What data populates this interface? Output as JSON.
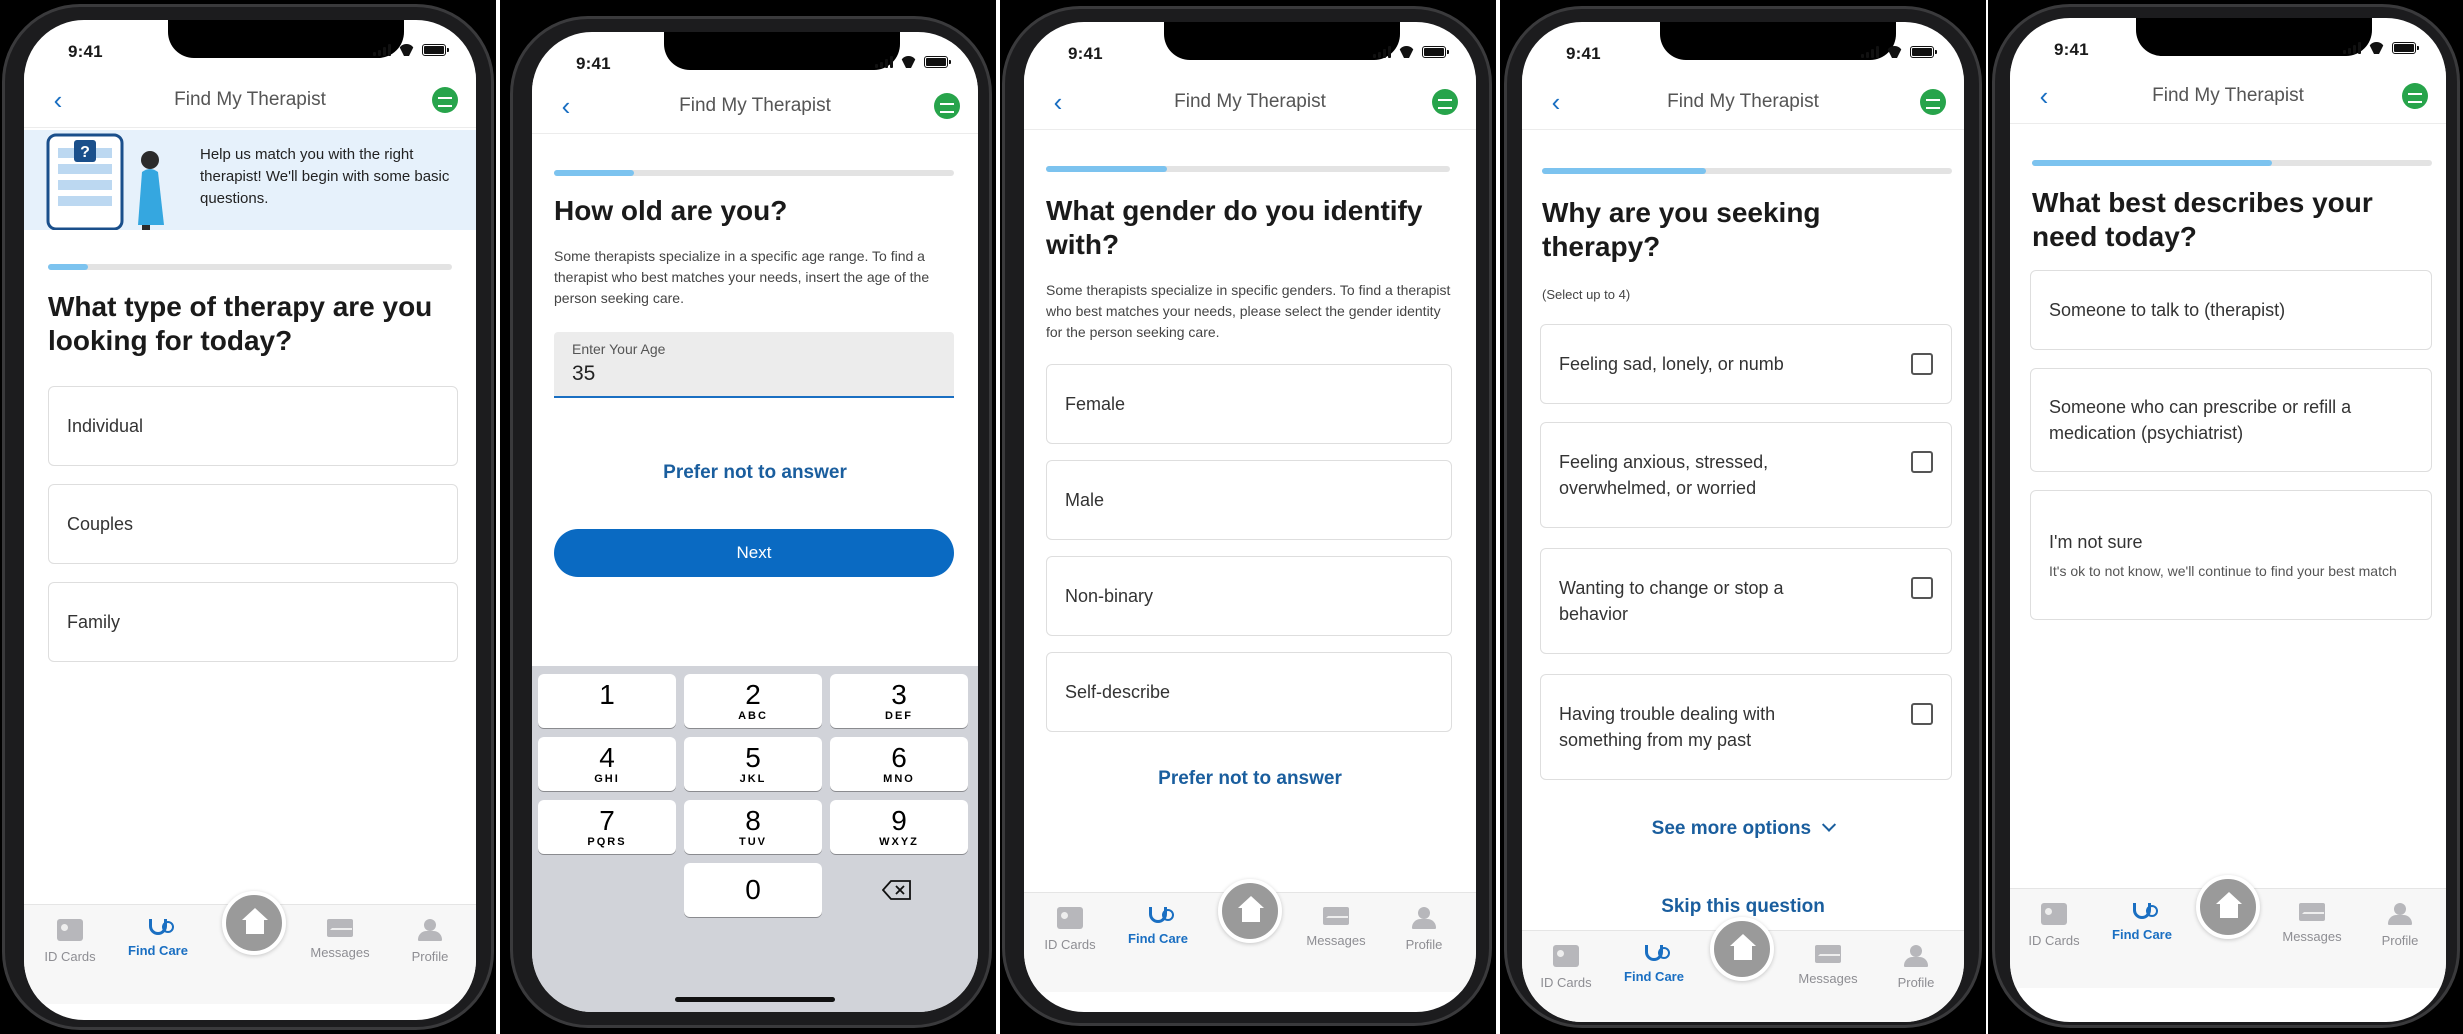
{
  "status_time": "9:41",
  "nav_title": "Find My Therapist",
  "tabs": [
    "ID Cards",
    "Find Care",
    "Messages",
    "Profile"
  ],
  "screen1": {
    "hero_text": "Help us match you with the right therapist! We'll begin with some basic questions.",
    "question": "What type of therapy are you looking for today?",
    "options": [
      "Individual",
      "Couples",
      "Family"
    ],
    "progress": 0.1
  },
  "screen2": {
    "question": "How old are you?",
    "description": "Some therapists specialize in a specific age range. To find a therapist who best matches your needs, insert the age of the person seeking care.",
    "input_label": "Enter Your Age",
    "input_value": "35",
    "prefer_not": "Prefer not to answer",
    "next_label": "Next",
    "progress": 0.2,
    "keys": [
      {
        "n": "1",
        "l": ""
      },
      {
        "n": "2",
        "l": "ABC"
      },
      {
        "n": "3",
        "l": "DEF"
      },
      {
        "n": "4",
        "l": "GHI"
      },
      {
        "n": "5",
        "l": "JKL"
      },
      {
        "n": "6",
        "l": "MNO"
      },
      {
        "n": "7",
        "l": "PQRS"
      },
      {
        "n": "8",
        "l": "TUV"
      },
      {
        "n": "9",
        "l": "WXYZ"
      },
      {
        "n": "0",
        "l": ""
      }
    ]
  },
  "screen3": {
    "question": "What gender do you identify with?",
    "description": "Some therapists specialize in specific genders. To find a therapist who best matches your needs, please select the gender identity for the person seeking care.",
    "options": [
      "Female",
      "Male",
      "Non-binary",
      "Self-describe"
    ],
    "prefer_not": "Prefer not to answer",
    "progress": 0.3
  },
  "screen4": {
    "question": "Why are you seeking therapy?",
    "hint": "(Select up to 4)",
    "options": [
      "Feeling sad, lonely, or numb",
      "Feeling anxious, stressed, overwhelmed, or worried",
      "Wanting to change or stop a behavior",
      "Having trouble dealing with something from my past"
    ],
    "see_more": "See more options",
    "skip": "Skip this question",
    "progress": 0.4
  },
  "screen5": {
    "question": "What best describes your need today?",
    "options": [
      "Someone to talk to (therapist)",
      "Someone who can prescribe or refill a medication (psychiatrist)",
      "I'm not sure"
    ],
    "not_sure_sub": "It's ok to not know, we'll continue to find your best match",
    "progress": 0.6
  }
}
